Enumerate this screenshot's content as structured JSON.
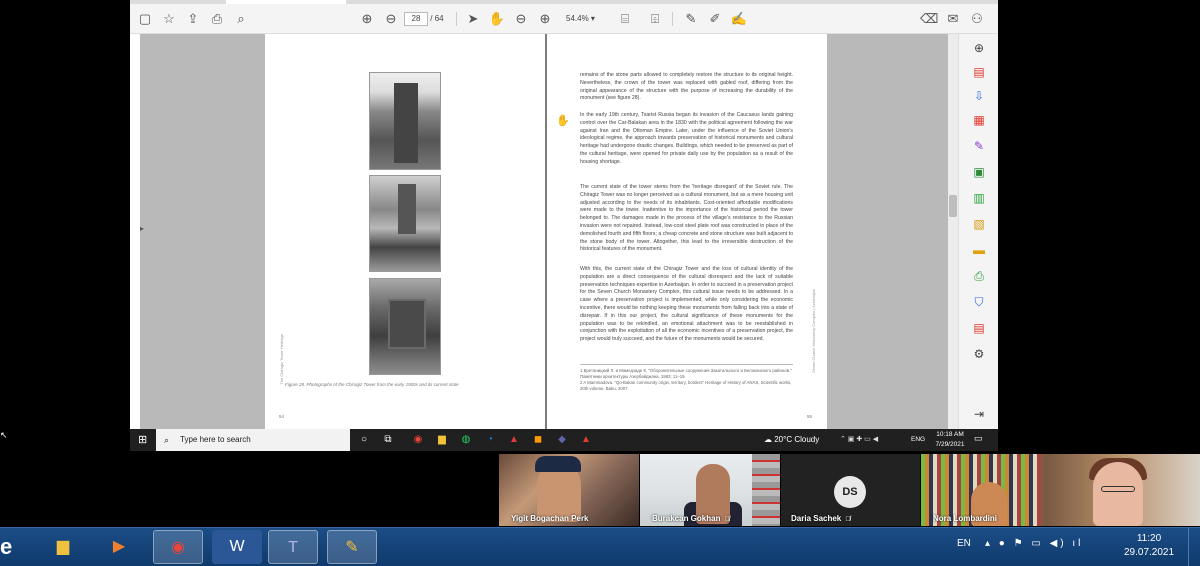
{
  "pdf_viewer": {
    "page_current": "28",
    "page_separator": "/",
    "page_total": "64",
    "zoom": "54.4%"
  },
  "left_page": {
    "caption": "Figure 28. Photographs of the Chiragiz Tower from the early 1900s and its current state",
    "side_label": "The Chiragiz Tower Heritage",
    "page_number": "54"
  },
  "right_page": {
    "paragraphs": [
      "remains of the stone parts allowed to completely restore the structure to its original height. Nevertheless, the crown of the tower was replaced with gabled roof, differing from the original appearance of the structure with the purpose of increasing the durability of the monument (see figure 28).",
      "In the early 19th century, Tsarist Russia began its invasion of the Caucasus lands gaining control over the Car-Balakan area in the 1830 with the political agreement following the war against Iran and the Ottoman Empire. Later, under the influence of the Soviet Union's ideological regime, the approach towards preservation of historical monuments and cultural heritage had undergone drastic changes. Buildings, which needed to be preserved as part of the cultural heritage, were opened for private daily use by the population as a result of the housing shortage.",
      "The current state of the tower stems from the 'heritage disregard' of the Soviet rule. The Chiragiz Tower was no longer perceived as a cultural monument, but as a mere housing unit adjusted according to the needs of its inhabitants. Cost-oriented affordable modifications were made to the tower. Inattentive to the importance of the historical period the tower belonged to. The damages made in the process of the village's resistance to the Russian invasion were not repaired. Instead, low-cost steel plate roof was constructed in place of the demolished fourth and fifth floors; a cheap concrete and stone structure was built adjacent to the stone body of the tower. Altogether, this lead to the irreversible destruction of the historical features of the monument.",
      "With this, the current state of the Chiragiz Tower and the loss of cultural identity of the population are a direct consequence of the cultural disrespect and the lack of suitable preservation techniques expertise in Azerbaijan. In order to succeed in a preservation project for the Seven Church Monastery Complex, this cultural issue needs to be addressed. In a case where a preservation project is implemented, while only considering the economic incentive, there would be nothing keeping these monuments from falling back into a state of disrepair. If in this our project, the cultural significance of these monuments for the population was to be rekindled, an emotional attachment was to be reestablished in conjunction with the exploitation of all the economic incentives of a preservation project, the project would truly succeed, and the future of the monuments would be secured."
    ],
    "footnotes": [
      "1  Бретаницкий Л. и Мамедзаде К. \"Оборонительные сооружения Закатальского и Белоканского районов.\" Памятники архитектуры Азербайджана. 1983: 11–19.",
      "2  A Mammadova. \"Qo-Bakan community origin, territory, borders\" Heritage of History of ANAS, Scientific works, 20th volume, Baku, 2007."
    ],
    "side_label": "Seven Church Monastery Complex | Azerbaijan",
    "page_number": "55"
  },
  "win_taskbar_inner": {
    "search_placeholder": "Type here to search",
    "weather": "20°C  Cloudy",
    "lang": "ENG",
    "time": "10:18 AM",
    "date": "7/29/2021"
  },
  "participants": [
    {
      "name": "Yigit Bogachan Perk",
      "muted": false
    },
    {
      "name": "Burakcan Gokhan",
      "muted": true
    },
    {
      "name": "Daria Sachek",
      "initials": "DS",
      "muted": true
    },
    {
      "name": "Nora Lombardini",
      "muted": false
    }
  ],
  "taskbar": {
    "lang": "EN",
    "time": "11:20",
    "date": "29.07.2021",
    "apps": [
      "file-explorer",
      "media-player",
      "chrome",
      "word",
      "teams",
      "paint"
    ]
  }
}
